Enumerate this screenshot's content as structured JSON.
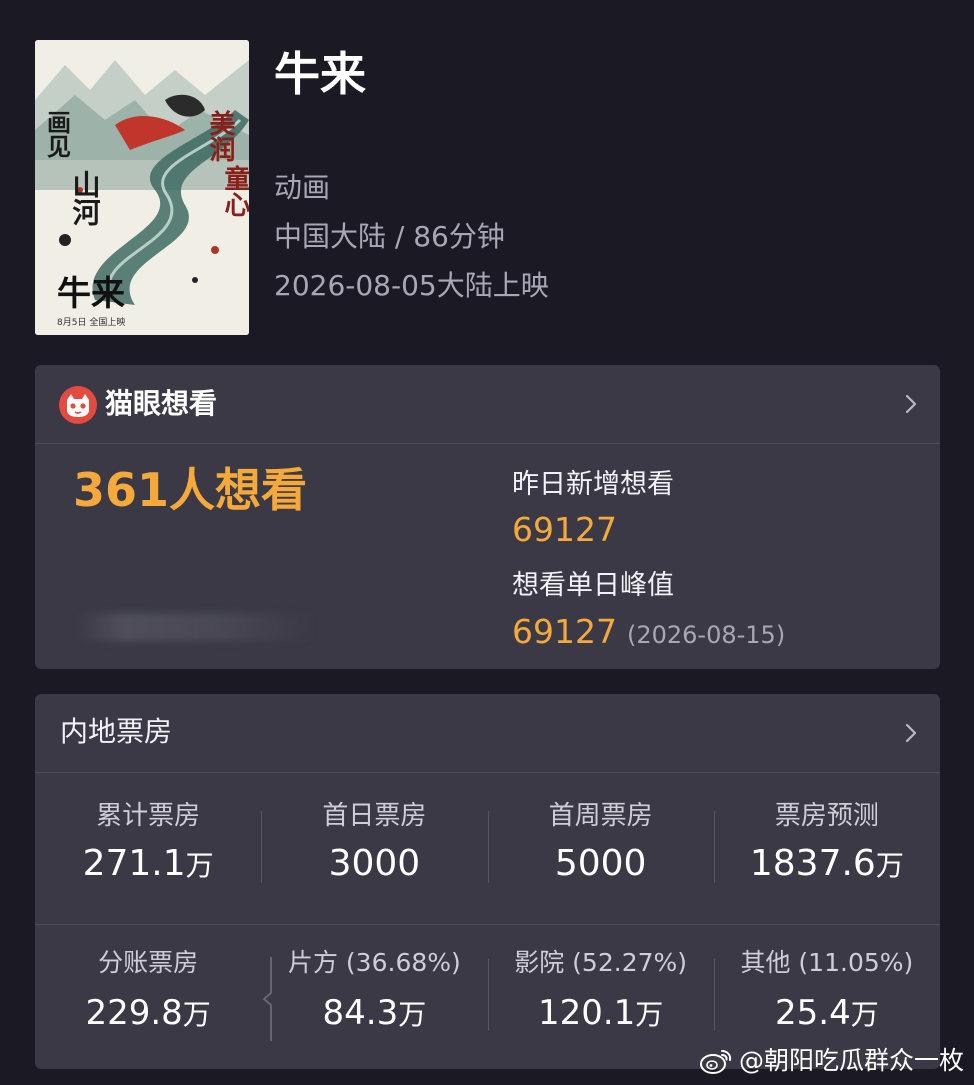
{
  "movie": {
    "title": "牛来",
    "genre": "动画",
    "region_duration": "中国大陆 / 86分钟",
    "release": "2026-08-05大陆上映",
    "poster": {
      "text_left": "画见山河",
      "text_right": "美润童心",
      "text_title": "牛来",
      "text_date": "8月5日 全国上映"
    }
  },
  "maoyan": {
    "brand": "猫眼想看",
    "want_count": "361人想看",
    "yesterday_label": "昨日新增想看",
    "yesterday_value": "69127",
    "peak_label": "想看单日峰值",
    "peak_value": "69127",
    "peak_date": "(2026-08-15)"
  },
  "boxoffice": {
    "title": "内地票房",
    "row1": [
      {
        "label": "累计票房",
        "value": "271.1",
        "unit": "万"
      },
      {
        "label": "首日票房",
        "value": "3000",
        "unit": ""
      },
      {
        "label": "首周票房",
        "value": "5000",
        "unit": ""
      },
      {
        "label": "票房预测",
        "value": "1837.6",
        "unit": "万"
      }
    ],
    "row2": [
      {
        "label": "分账票房",
        "value": "229.8",
        "unit": "万"
      },
      {
        "label": "片方 (36.68%)",
        "value": "84.3",
        "unit": "万"
      },
      {
        "label": "影院 (52.27%)",
        "value": "120.1",
        "unit": "万"
      },
      {
        "label": "其他 (11.05%)",
        "value": "25.4",
        "unit": "万"
      }
    ]
  },
  "watermark": "@朝阳吃瓜群众一枚",
  "colors": {
    "background": "#1b1a24",
    "card": "#3a3945",
    "accent_orange": "#f6a93b",
    "maoyan_red": "#e34b3f"
  },
  "icons": [
    "maoyan-cat-icon",
    "chevron-right-icon",
    "weibo-icon"
  ]
}
